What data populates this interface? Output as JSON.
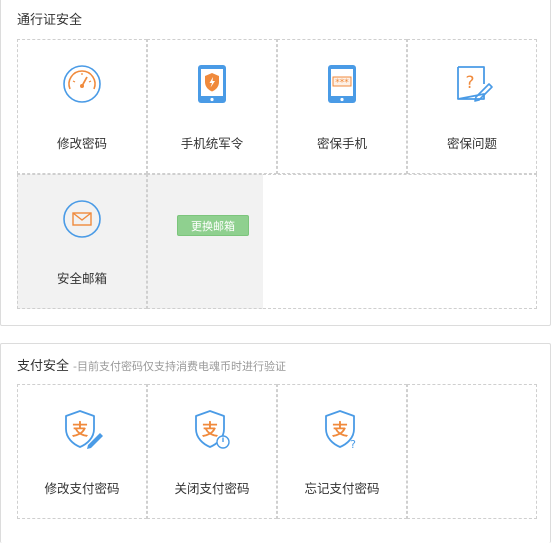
{
  "passport_security": {
    "title": "通行证安全",
    "items": [
      {
        "label": "修改密码",
        "icon": "speedometer-icon"
      },
      {
        "label": "手机统军令",
        "icon": "tablet-shield-icon"
      },
      {
        "label": "密保手机",
        "icon": "tablet-password-icon"
      },
      {
        "label": "密保问题",
        "icon": "question-edit-icon"
      },
      {
        "label": "安全邮箱",
        "icon": "envelope-icon"
      }
    ],
    "change_email_button": "更换邮箱"
  },
  "payment_security": {
    "title": "支付安全",
    "subtitle": "-目前支付密码仅支持消费电魂币时进行验证",
    "items": [
      {
        "label": "修改支付密码",
        "icon": "pay-shield-edit-icon"
      },
      {
        "label": "关闭支付密码",
        "icon": "pay-shield-power-icon"
      },
      {
        "label": "忘记支付密码",
        "icon": "pay-shield-question-icon"
      }
    ],
    "shield_char": "支"
  },
  "colors": {
    "icon_blue": "#4a9be6",
    "icon_orange": "#f08a3c",
    "button_green": "#8fd08f"
  }
}
